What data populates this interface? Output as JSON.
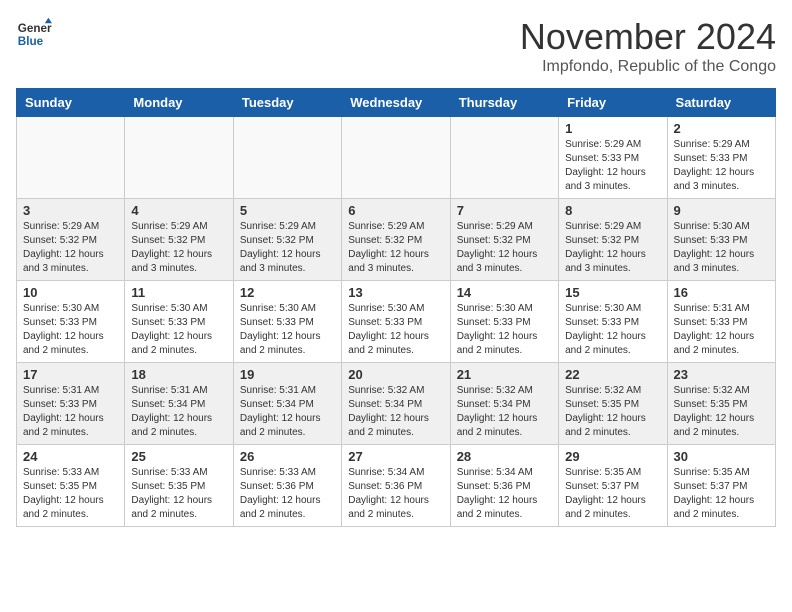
{
  "logo": {
    "line1": "General",
    "line2": "Blue"
  },
  "title": "November 2024",
  "location": "Impfondo, Republic of the Congo",
  "days_of_week": [
    "Sunday",
    "Monday",
    "Tuesday",
    "Wednesday",
    "Thursday",
    "Friday",
    "Saturday"
  ],
  "weeks": [
    [
      {
        "day": "",
        "info": ""
      },
      {
        "day": "",
        "info": ""
      },
      {
        "day": "",
        "info": ""
      },
      {
        "day": "",
        "info": ""
      },
      {
        "day": "",
        "info": ""
      },
      {
        "day": "1",
        "info": "Sunrise: 5:29 AM\nSunset: 5:33 PM\nDaylight: 12 hours\nand 3 minutes."
      },
      {
        "day": "2",
        "info": "Sunrise: 5:29 AM\nSunset: 5:33 PM\nDaylight: 12 hours\nand 3 minutes."
      }
    ],
    [
      {
        "day": "3",
        "info": "Sunrise: 5:29 AM\nSunset: 5:32 PM\nDaylight: 12 hours\nand 3 minutes."
      },
      {
        "day": "4",
        "info": "Sunrise: 5:29 AM\nSunset: 5:32 PM\nDaylight: 12 hours\nand 3 minutes."
      },
      {
        "day": "5",
        "info": "Sunrise: 5:29 AM\nSunset: 5:32 PM\nDaylight: 12 hours\nand 3 minutes."
      },
      {
        "day": "6",
        "info": "Sunrise: 5:29 AM\nSunset: 5:32 PM\nDaylight: 12 hours\nand 3 minutes."
      },
      {
        "day": "7",
        "info": "Sunrise: 5:29 AM\nSunset: 5:32 PM\nDaylight: 12 hours\nand 3 minutes."
      },
      {
        "day": "8",
        "info": "Sunrise: 5:29 AM\nSunset: 5:32 PM\nDaylight: 12 hours\nand 3 minutes."
      },
      {
        "day": "9",
        "info": "Sunrise: 5:30 AM\nSunset: 5:33 PM\nDaylight: 12 hours\nand 3 minutes."
      }
    ],
    [
      {
        "day": "10",
        "info": "Sunrise: 5:30 AM\nSunset: 5:33 PM\nDaylight: 12 hours\nand 2 minutes."
      },
      {
        "day": "11",
        "info": "Sunrise: 5:30 AM\nSunset: 5:33 PM\nDaylight: 12 hours\nand 2 minutes."
      },
      {
        "day": "12",
        "info": "Sunrise: 5:30 AM\nSunset: 5:33 PM\nDaylight: 12 hours\nand 2 minutes."
      },
      {
        "day": "13",
        "info": "Sunrise: 5:30 AM\nSunset: 5:33 PM\nDaylight: 12 hours\nand 2 minutes."
      },
      {
        "day": "14",
        "info": "Sunrise: 5:30 AM\nSunset: 5:33 PM\nDaylight: 12 hours\nand 2 minutes."
      },
      {
        "day": "15",
        "info": "Sunrise: 5:30 AM\nSunset: 5:33 PM\nDaylight: 12 hours\nand 2 minutes."
      },
      {
        "day": "16",
        "info": "Sunrise: 5:31 AM\nSunset: 5:33 PM\nDaylight: 12 hours\nand 2 minutes."
      }
    ],
    [
      {
        "day": "17",
        "info": "Sunrise: 5:31 AM\nSunset: 5:33 PM\nDaylight: 12 hours\nand 2 minutes."
      },
      {
        "day": "18",
        "info": "Sunrise: 5:31 AM\nSunset: 5:34 PM\nDaylight: 12 hours\nand 2 minutes."
      },
      {
        "day": "19",
        "info": "Sunrise: 5:31 AM\nSunset: 5:34 PM\nDaylight: 12 hours\nand 2 minutes."
      },
      {
        "day": "20",
        "info": "Sunrise: 5:32 AM\nSunset: 5:34 PM\nDaylight: 12 hours\nand 2 minutes."
      },
      {
        "day": "21",
        "info": "Sunrise: 5:32 AM\nSunset: 5:34 PM\nDaylight: 12 hours\nand 2 minutes."
      },
      {
        "day": "22",
        "info": "Sunrise: 5:32 AM\nSunset: 5:35 PM\nDaylight: 12 hours\nand 2 minutes."
      },
      {
        "day": "23",
        "info": "Sunrise: 5:32 AM\nSunset: 5:35 PM\nDaylight: 12 hours\nand 2 minutes."
      }
    ],
    [
      {
        "day": "24",
        "info": "Sunrise: 5:33 AM\nSunset: 5:35 PM\nDaylight: 12 hours\nand 2 minutes."
      },
      {
        "day": "25",
        "info": "Sunrise: 5:33 AM\nSunset: 5:35 PM\nDaylight: 12 hours\nand 2 minutes."
      },
      {
        "day": "26",
        "info": "Sunrise: 5:33 AM\nSunset: 5:36 PM\nDaylight: 12 hours\nand 2 minutes."
      },
      {
        "day": "27",
        "info": "Sunrise: 5:34 AM\nSunset: 5:36 PM\nDaylight: 12 hours\nand 2 minutes."
      },
      {
        "day": "28",
        "info": "Sunrise: 5:34 AM\nSunset: 5:36 PM\nDaylight: 12 hours\nand 2 minutes."
      },
      {
        "day": "29",
        "info": "Sunrise: 5:35 AM\nSunset: 5:37 PM\nDaylight: 12 hours\nand 2 minutes."
      },
      {
        "day": "30",
        "info": "Sunrise: 5:35 AM\nSunset: 5:37 PM\nDaylight: 12 hours\nand 2 minutes."
      }
    ]
  ]
}
